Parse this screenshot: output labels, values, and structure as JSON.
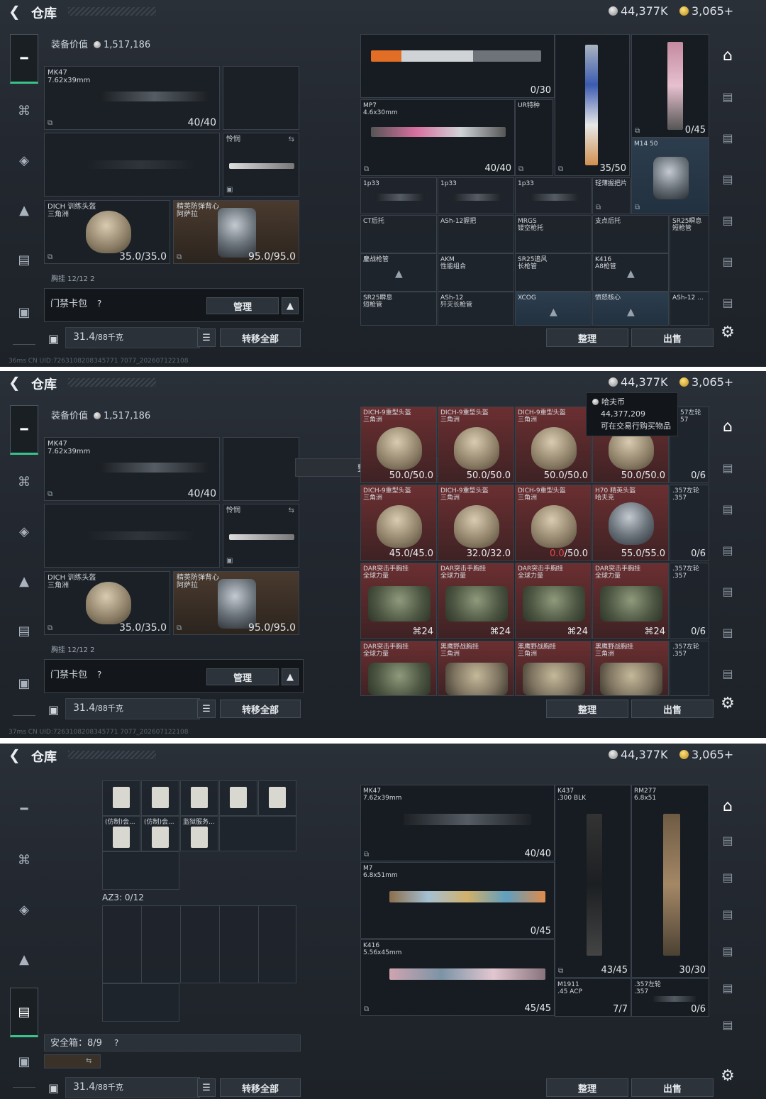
{
  "header": {
    "back_icon": "back-arrow-icon",
    "title": "仓库",
    "currency_silver": "44,377K",
    "currency_gold": "3,065+"
  },
  "colors": {
    "accent_green": "#39c28a",
    "red_slot": "#6b2f31",
    "bg": "#232830"
  },
  "sidebar_icons": [
    "gun-icon",
    "armor-icon",
    "vest-icon",
    "backpack-icon",
    "case-icon",
    "toolbox-icon"
  ],
  "right_icons": [
    "home-icon",
    "attachment-icon",
    "settings-icon"
  ],
  "panel1": {
    "equip_value_label": "装备价值",
    "equip_value": "1,517,186",
    "primary": {
      "name": "MK47",
      "caliber": "7.62x39mm",
      "ammo": "40/40"
    },
    "melee": {
      "name": "怜悯"
    },
    "helmet": {
      "name": "DICH 训练头盔",
      "sub": "三角洲",
      "dur": "35.0/35.0"
    },
    "armor": {
      "name": "精英防弹背心",
      "sub": "阿萨拉",
      "dur": "95.0/95.0"
    },
    "chest_row": "胸挂  12/12  2",
    "keycard_label": "门禁卡包",
    "help": "?",
    "manage": "管理",
    "weight": "31.4",
    "weight_max": "/88千克",
    "transfer_all": "转移全部",
    "arrange": "整理",
    "sell": "出售",
    "status": "36ms     CN UID:7263108208345771 7077_202607122108",
    "items": [
      {
        "name": "",
        "ammo": "0/30"
      },
      {
        "name": "MP7\n4.6x30mm",
        "ammo": "40/40"
      },
      {
        "name": "UR特种",
        "ammo": ""
      },
      {
        "name": "",
        "ammo": "35/50"
      },
      {
        "name": "",
        "ammo": "0/45"
      },
      {
        "name": "M14 50",
        "ammo": ""
      },
      {
        "name": "1p33",
        "ammo": ""
      },
      {
        "name": "1p33",
        "ammo": ""
      },
      {
        "name": "1p33",
        "ammo": ""
      },
      {
        "name": "轻薄握把片",
        "ammo": ""
      },
      {
        "name": "CT后托",
        "ammo": ""
      },
      {
        "name": "ASh-12握把",
        "ammo": ""
      },
      {
        "name": "MRGS\n镂空枪托",
        "ammo": ""
      },
      {
        "name": "支点后托",
        "ammo": ""
      },
      {
        "name": "SR25瞬息\n短枪管",
        "ammo": ""
      },
      {
        "name": "鏖战枪管",
        "ammo": ""
      },
      {
        "name": "AKM\n性能组合",
        "ammo": ""
      },
      {
        "name": "SR25追风\n长枪管",
        "ammo": ""
      },
      {
        "name": "K416\nA8枪管",
        "ammo": ""
      },
      {
        "name": "SR25瞬息\n短枪管",
        "ammo": ""
      },
      {
        "name": "ASh-12\n歼灭长枪管",
        "ammo": ""
      },
      {
        "name": "XCOG",
        "ammo": ""
      },
      {
        "name": "愤怒核心",
        "ammo": ""
      },
      {
        "name": "ASh-12 ...",
        "ammo": ""
      }
    ]
  },
  "panel2": {
    "toast": "整理成功",
    "tip_title": "哈夫币",
    "tip_value": "44,377,209",
    "tip_desc": "可在交易行购买物品",
    "status": "37ms     CN UID:7263108208345771 7077_202607122108",
    "helmets": [
      {
        "name": "DICH-9重型头盔\n三角洲",
        "dur": "50.0/50.0"
      },
      {
        "name": "DICH-9重型头盔\n三角洲",
        "dur": "50.0/50.0"
      },
      {
        "name": "DICH-9重型头盔\n三角洲",
        "dur": "50.0/50.0"
      },
      {
        "name": "",
        "dur": "50.0/50.0"
      },
      {
        "name": "DICH-9重型头盔\n三角洲",
        "dur": "45.0/45.0"
      },
      {
        "name": "DICH-9重型头盔\n三角洲",
        "dur": "32.0/32.0"
      },
      {
        "name": "DICH-9重型头盔\n三角洲",
        "dur_red": "0.0",
        "dur": "/50.0"
      },
      {
        "name": "H70 精英头盔\n哈夫克",
        "dur": "55.0/55.0"
      }
    ],
    "side": [
      {
        "name": ".357左轮\n.357",
        "ammo": "0/6"
      },
      {
        "name": ".357左轮\n.357",
        "ammo": "0/6"
      },
      {
        "name": ".357左轮\n.357",
        "ammo": "0/6"
      },
      {
        "name": ".357左轮\n.357",
        "ammo": ""
      }
    ],
    "bags": [
      {
        "name": "DAR突击手胸挂\n全球力量",
        "count": "24"
      },
      {
        "name": "DAR突击手胸挂\n全球力量",
        "count": "24"
      },
      {
        "name": "DAR突击手胸挂\n全球力量",
        "count": "24"
      },
      {
        "name": "DAR突击手胸挂\n全球力量",
        "count": "24"
      },
      {
        "name": "DAR突击手胸挂\n全球力量",
        "count": ""
      },
      {
        "name": "黑鹰野战胸挂\n三角洲",
        "count": ""
      },
      {
        "name": "黑鹰野战胸挂\n三角洲",
        "count": ""
      },
      {
        "name": "黑鹰野战胸挂\n三角洲",
        "count": ""
      }
    ],
    "top_right_partial": "57左轮\n57"
  },
  "panel3": {
    "card_labels": [
      "(仿制)会...",
      "(仿制)会...",
      "监狱服务..."
    ],
    "az3": "AZ3: 0/12",
    "safe_box": "安全箱：8/9",
    "guns": [
      {
        "name": "MK47\n7.62x39mm",
        "ammo": "40/40"
      },
      {
        "name": "M7\n6.8x51mm",
        "ammo": "0/45"
      },
      {
        "name": "K416\n5.56x45mm",
        "ammo": "45/45"
      },
      {
        "name": "K437\n.300 BLK",
        "ammo": "43/45"
      },
      {
        "name": "RM277\n6.8x51",
        "ammo": "30/30"
      },
      {
        "name": "M1911\n.45 ACP",
        "ammo": "7/7"
      },
      {
        "name": ".357左轮\n.357",
        "ammo": "0/6"
      }
    ]
  }
}
